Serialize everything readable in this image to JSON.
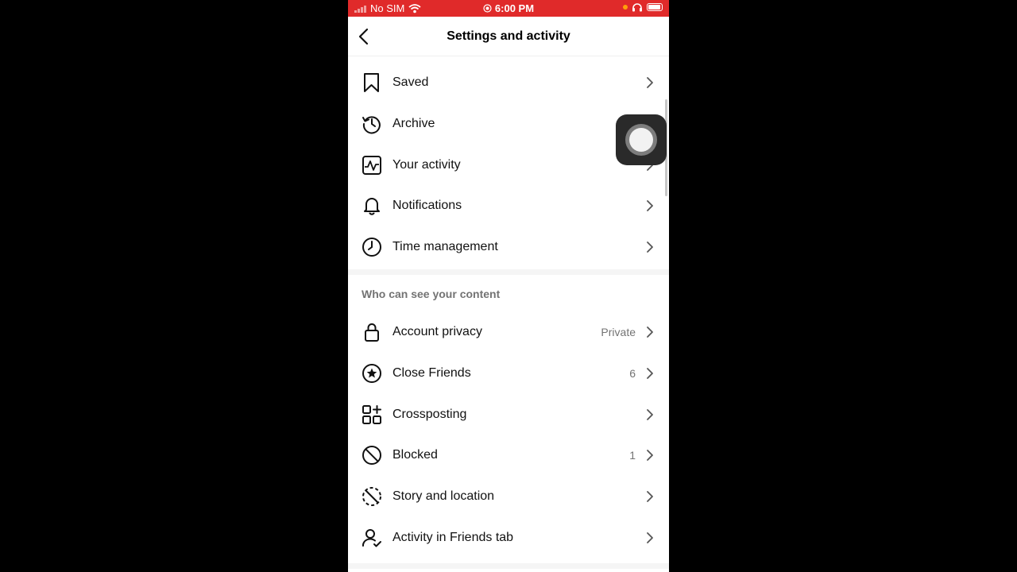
{
  "status": {
    "carrier": "No SIM",
    "time": "6:00 PM"
  },
  "header": {
    "title": "Settings and activity"
  },
  "section": {
    "label": "Who can see your content"
  },
  "items": [
    {
      "label": "Saved",
      "value": "",
      "icon": "bookmark-icon"
    },
    {
      "label": "Archive",
      "value": "",
      "icon": "archive-icon"
    },
    {
      "label": "Your activity",
      "value": "",
      "icon": "activity-icon"
    },
    {
      "label": "Notifications",
      "value": "",
      "icon": "bell-icon"
    },
    {
      "label": "Time management",
      "value": "",
      "icon": "clock-icon"
    },
    {
      "label": "Account privacy",
      "value": "Private",
      "icon": "lock-icon"
    },
    {
      "label": "Close Friends",
      "value": "6",
      "icon": "star-circle-icon"
    },
    {
      "label": "Crossposting",
      "value": "",
      "icon": "crosspost-icon"
    },
    {
      "label": "Blocked",
      "value": "1",
      "icon": "blocked-icon"
    },
    {
      "label": "Story and location",
      "value": "",
      "icon": "story-location-icon"
    },
    {
      "label": "Activity in Friends tab",
      "value": "",
      "icon": "friends-activity-icon"
    }
  ]
}
